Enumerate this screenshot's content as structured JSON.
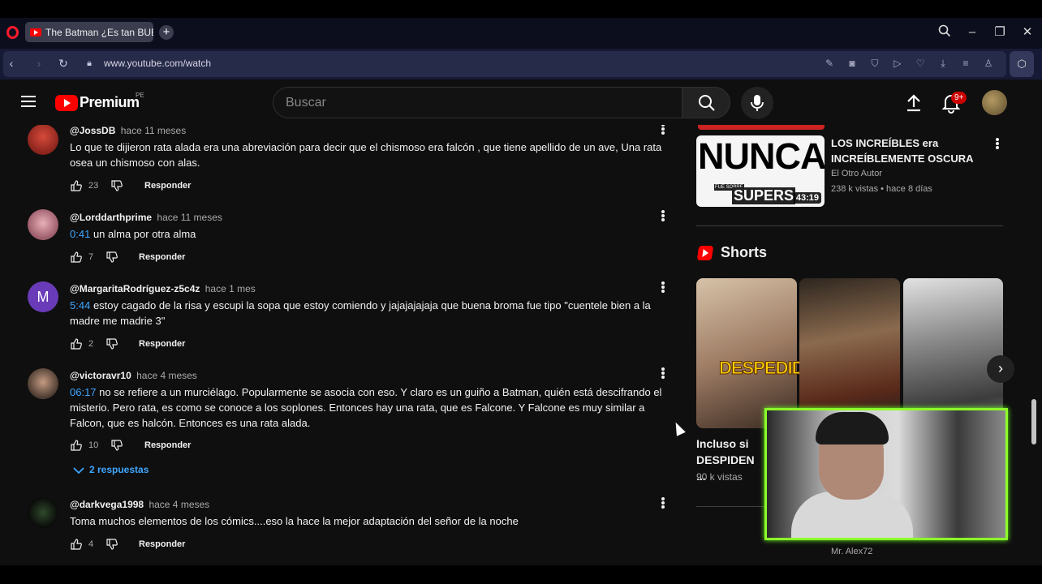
{
  "browser": {
    "tab_title": "The Batman ¿Es tan BUEN",
    "url": "www.youtube.com/watch"
  },
  "masthead": {
    "logo": "Premium",
    "logo_region": "PE",
    "search_placeholder": "Buscar",
    "notification_count": "9+"
  },
  "comments": [
    {
      "user": "@JossDB",
      "time": "hace 11 meses",
      "timestamp": "",
      "text": "Lo que te dijieron rata alada era una abreviación para decir que el chismoso era falcón , que tiene apellido de un ave, Una rata osea un chismoso con alas.",
      "likes": "23",
      "reply": "Responder"
    },
    {
      "user": "@Lorddarthprime",
      "time": "hace 11 meses",
      "timestamp": "0:41",
      "text": "un alma por otra alma",
      "likes": "7",
      "reply": "Responder"
    },
    {
      "user": "@MargaritaRodríguez-z5c4z",
      "time": "hace 1 mes",
      "timestamp": "5:44",
      "text": "estoy cagado de la risa y  escupi la sopa que estoy comiendo y jajajajajaja que buena broma fue tipo \"cuentele bien a la madre me madrie 3\"",
      "likes": "2",
      "reply": "Responder",
      "avatar_letter": "M"
    },
    {
      "user": "@victoravr10",
      "time": "hace 4 meses",
      "timestamp": "06:17",
      "text": "no se refiere a un murciélago. Popularmente se asocia con eso. Y claro es un guiño a Batman, quién está descifrando el misterio. Pero rata, es como se conoce a los soplones. Entonces hay una rata, que es Falcone. Y Falcone es muy similar a Falcon, que es halcón. Entonces es una rata alada.",
      "likes": "10",
      "reply": "Responder",
      "replies_label": "2 respuestas"
    },
    {
      "user": "@darkvega1998",
      "time": "hace 4 meses",
      "timestamp": "",
      "text": "Toma muchos elementos de los cómics....eso la hace la mejor adaptación del señor de la noche",
      "likes": "4",
      "reply": "Responder"
    }
  ],
  "related": {
    "thumb_text": "NUNCA",
    "thumb_sub": "SUPERS",
    "thumb_small": "FUE SOBRE",
    "duration": "43:19",
    "title": "LOS INCREÍBLES era INCREÍBLEMENTE OSCURA",
    "channel": "El Otro Autor",
    "meta": "238 k vistas • hace 8 días"
  },
  "shorts": {
    "heading": "Shorts",
    "overlay_text": "DESPEDIDO",
    "first_title": "Incluso si DESPIDEN ...",
    "first_views": "90 k vistas"
  },
  "webcam": {
    "name": "Mr. Alex72"
  },
  "colors": {
    "accent_link": "#3ea6ff",
    "brand_red": "#ff0000",
    "webcam_border": "#8cff2a"
  }
}
